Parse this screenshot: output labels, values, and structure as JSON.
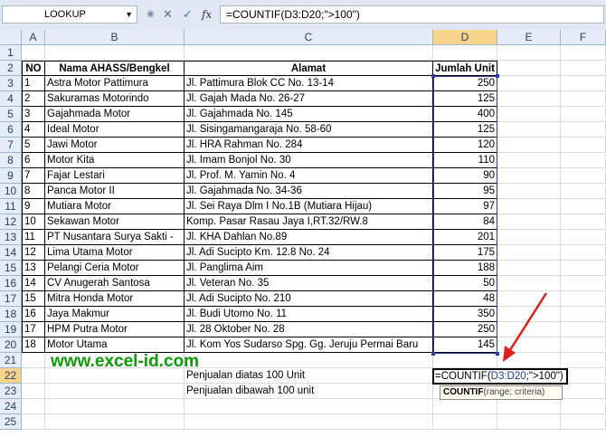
{
  "formula_bar": {
    "name_box": "LOOKUP",
    "formula": "=COUNTIF(D3:D20;\">100\")",
    "cancel_icon": "x-icon",
    "enter_icon": "check-icon",
    "fx_label": "fx"
  },
  "columns": [
    "A",
    "B",
    "C",
    "D",
    "E",
    "F"
  ],
  "row_numbers": [
    "1",
    "2",
    "3",
    "4",
    "5",
    "6",
    "7",
    "8",
    "9",
    "10",
    "11",
    "12",
    "13",
    "14",
    "15",
    "16",
    "17",
    "18",
    "19",
    "20",
    "21",
    "22",
    "23",
    "24",
    "25"
  ],
  "table": {
    "headers": [
      "NO",
      "Nama AHASS/Bengkel",
      "Alamat",
      "Jumlah Unit"
    ],
    "rows": [
      [
        "1",
        "Astra Motor Pattimura",
        "Jl. Pattimura Blok CC No. 13-14",
        "250"
      ],
      [
        "2",
        "Sakuramas Motorindo",
        "Jl. Gajah Mada No. 26-27",
        "125"
      ],
      [
        "3",
        "Gajahmada Motor",
        "Jl. Gajahmada No. 145",
        "400"
      ],
      [
        "4",
        "Ideal Motor",
        "Jl. Sisingamangaraja No. 58-60",
        "125"
      ],
      [
        "5",
        "Jawi Motor",
        "Jl. HRA Rahman No. 284",
        "120"
      ],
      [
        "6",
        "Motor Kita",
        "Jl. Imam Bonjol No. 30",
        "110"
      ],
      [
        "7",
        "Fajar Lestari",
        "Jl. Prof. M. Yamin No. 4",
        "90"
      ],
      [
        "8",
        "Panca Motor II",
        "Jl. Gajahmada No. 34-36",
        "95"
      ],
      [
        "9",
        "Mutiara Motor",
        "Jl. Sei Raya Dlm I No.1B (Mutiara Hijau)",
        "97"
      ],
      [
        "10",
        "Sekawan Motor",
        "Komp. Pasar Rasau Jaya I,RT.32/RW.8",
        "84"
      ],
      [
        "11",
        "PT Nusantara Surya Sakti -",
        "Jl. KHA Dahlan No.89",
        "201"
      ],
      [
        "12",
        "Lima Utama Motor",
        "Jl. Adi Sucipto Km. 12.8 No. 24",
        "175"
      ],
      [
        "13",
        "Pelangi Ceria Motor",
        "Jl. Panglima Aim",
        "188"
      ],
      [
        "14",
        "CV Anugerah Santosa",
        "Jl. Veteran No. 35",
        "50"
      ],
      [
        "15",
        "Mitra Honda Motor",
        "Jl. Adi Sucipto No. 210",
        "48"
      ],
      [
        "16",
        "Jaya Makmur",
        "Jl. Budi Utomo No. 11",
        "350"
      ],
      [
        "17",
        "HPM Putra Motor",
        "Jl. 28 Oktober No. 28",
        "250"
      ],
      [
        "18",
        "Motor Utama",
        "Jl. Kom Yos Sudarso Spg. Gg. Jeruju Permai Baru",
        "145"
      ]
    ]
  },
  "summary": {
    "above_label": "Penjualan diatas 100 Unit",
    "below_label": "Penjualan dibawah 100 unit",
    "editing_prefix": "=COUNTIF(",
    "editing_ref": "D3:D20",
    "editing_suffix": ";\">100\")",
    "tooltip_func": "COUNTIF",
    "tooltip_args": "(range; criteria)"
  },
  "watermark": "www.excel-id.com",
  "colors": {
    "selection": "#2b3ea5",
    "header_selected": "#f7d48a",
    "watermark": "#0a9a0a",
    "arrow": "#e02020"
  }
}
